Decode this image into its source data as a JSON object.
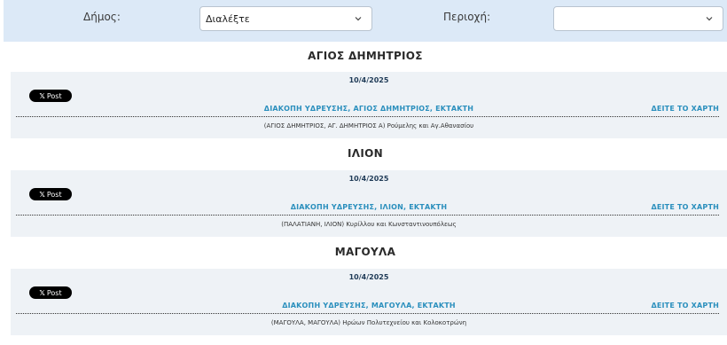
{
  "filters": {
    "municipality_label": "Δήμος:",
    "municipality_value": "Διαλέξτε",
    "area_label": "Περιοχή:",
    "area_value": ""
  },
  "areas": [
    {
      "title": "ΑΓΙΟΣ ΔΗΜΗΤΡΙΟΣ",
      "date": "10/4/2025",
      "share_label": "Post",
      "event": "ΔΙΑΚΟΠΗ ΥΔΡΕΥΣΗΣ, ΑΓΙΟΣ ΔΗΜΗΤΡΙΟΣ, ΕΚΤΑΚΤΗ",
      "map_link": "ΔΕΙΤΕ ΤΟ ΧΑΡΤΗ",
      "streets": "(ΑΓΙΟΣ ΔΗΜΗΤΡΙΟΣ, ΑΓ. ΔΗΜΗΤΡΙΟΣ Α) Ρούμελης και Αγ.Αθανασίου"
    },
    {
      "title": "ΙΛΙΟΝ",
      "date": "10/4/2025",
      "share_label": "Post",
      "event": "ΔΙΑΚΟΠΗ ΥΔΡΕΥΣΗΣ, ΙΛΙΟΝ, ΕΚΤΑΚΤΗ",
      "map_link": "ΔΕΙΤΕ ΤΟ ΧΑΡΤΗ",
      "streets": "(ΠΑΛΑΤΙΑΝΗ, ΙΛΙΟΝ) Κυρίλλου και Κωνσταντινουπόλεως"
    },
    {
      "title": "ΜΑΓΟΥΛΑ",
      "date": "10/4/2025",
      "share_label": "Post",
      "event": "ΔΙΑΚΟΠΗ ΥΔΡΕΥΣΗΣ, ΜΑΓΟΥΛΑ, ΕΚΤΑΚΤΗ",
      "map_link": "ΔΕΙΤΕ ΤΟ ΧΑΡΤΗ",
      "streets": "(ΜΑΓΟΥΛΑ, ΜΑΓΟΥΛΑ) Ηρώων Πολυτεχνείου και Κολοκοτρώνη"
    }
  ]
}
